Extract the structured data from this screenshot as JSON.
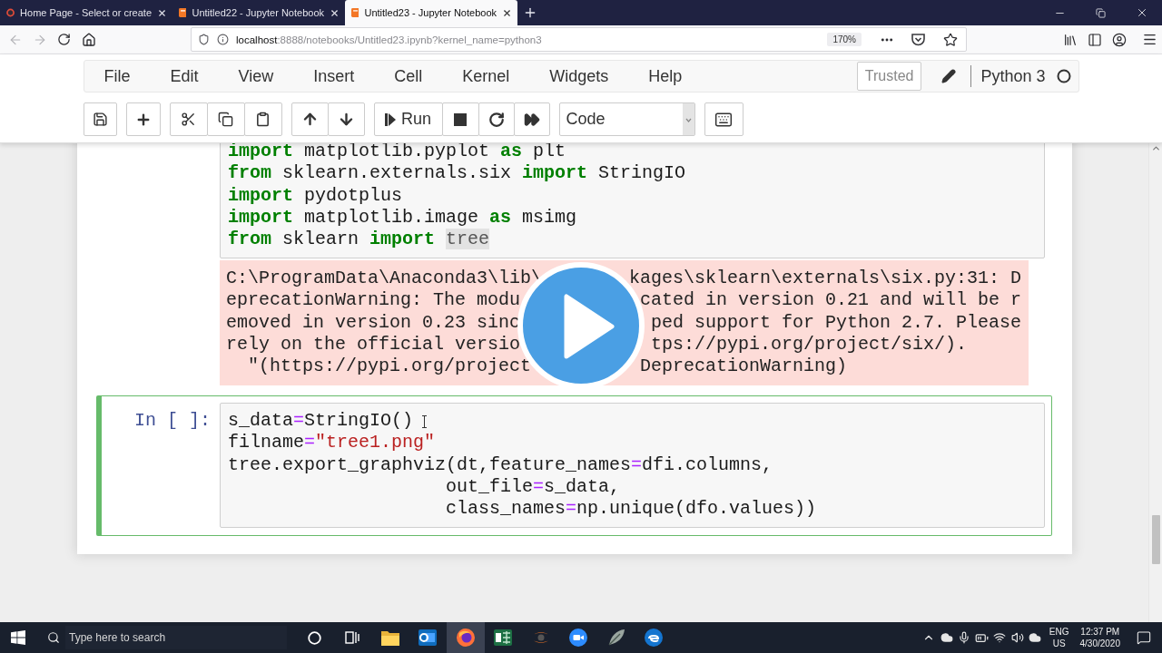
{
  "browser": {
    "tabs": [
      {
        "kind": "home",
        "title": "Home Page - Select or create",
        "selected": false
      },
      {
        "kind": "notebook",
        "title": "Untitled22 - Jupyter Notebook",
        "selected": false
      },
      {
        "kind": "notebook",
        "title": "Untitled23 - Jupyter Notebook",
        "selected": true
      }
    ],
    "back_disabled": true,
    "forward_disabled": true,
    "address": {
      "host": "localhost",
      "rest": ":8888/notebooks/Untitled23.ipynb?kernel_name=python3"
    },
    "zoom": "170%"
  },
  "notebook": {
    "menu": [
      "File",
      "Edit",
      "View",
      "Insert",
      "Cell",
      "Kernel",
      "Widgets",
      "Help"
    ],
    "trusted": "Trusted",
    "kernel": "Python 3",
    "kernel_busy": false,
    "toolbar": {
      "run": "Run",
      "cell_type": "Code"
    },
    "cells": [
      {
        "selected": false,
        "lines": [
          [
            {
              "kind": "kw",
              "text": "import"
            },
            {
              "kind": "name",
              "text": " matplotlib.pyplot "
            },
            {
              "kind": "kw",
              "text": "as"
            },
            {
              "kind": "name",
              "text": " plt"
            }
          ],
          [
            {
              "kind": "kw",
              "text": "from"
            },
            {
              "kind": "name",
              "text": " sklearn.externals.six "
            },
            {
              "kind": "kw",
              "text": "import"
            },
            {
              "kind": "name",
              "text": " StringIO"
            }
          ],
          [
            {
              "kind": "kw",
              "text": "import"
            },
            {
              "kind": "name",
              "text": " pydotplus"
            }
          ],
          [
            {
              "kind": "kw",
              "text": "import"
            },
            {
              "kind": "name",
              "text": " matplotlib.image "
            },
            {
              "kind": "kw",
              "text": "as"
            },
            {
              "kind": "name",
              "text": " msimg"
            }
          ],
          [
            {
              "kind": "kw",
              "text": "from"
            },
            {
              "kind": "name",
              "text": " sklearn "
            },
            {
              "kind": "kw",
              "text": "import "
            },
            {
              "kind": "match",
              "text": "tree"
            }
          ]
        ],
        "output": {
          "kind": "stderr",
          "lines": [
            {
              "left": "C:\\ProgramData\\Anaconda3\\lib\\",
              "right": "kages\\sklearn\\externals\\six.py:31: D"
            },
            {
              "left": "eprecationWarning: The modu",
              "right": "cated in version 0.21 and will be r"
            },
            {
              "left": "emoved in version 0.23 sinc",
              "right": "ped support for Python 2.7. Please"
            },
            {
              "left": "rely on the official versio",
              "right": "tps://pypi.org/project/six/)."
            },
            {
              "left": "  \"(https://pypi.org/project",
              "right": "DeprecationWarning)"
            }
          ]
        }
      },
      {
        "selected": true,
        "prompt": "In [ ]:",
        "lines": [
          [
            {
              "kind": "name",
              "text": "s_data"
            },
            {
              "kind": "op",
              "text": "="
            },
            {
              "kind": "name",
              "text": "StringIO()"
            }
          ],
          [
            {
              "kind": "name",
              "text": "filname"
            },
            {
              "kind": "op",
              "text": "="
            },
            {
              "kind": "str",
              "text": "\"tree1.png\""
            }
          ],
          [
            {
              "kind": "name",
              "text": "tree.export_graphviz(dt,feature_names"
            },
            {
              "kind": "op",
              "text": "="
            },
            {
              "kind": "name",
              "text": "dfi.columns,"
            }
          ],
          [
            {
              "kind": "name",
              "text": "                    out_file"
            },
            {
              "kind": "op",
              "text": "="
            },
            {
              "kind": "name",
              "text": "s_data,"
            }
          ],
          [
            {
              "kind": "name",
              "text": "                    class_names"
            },
            {
              "kind": "op",
              "text": "="
            },
            {
              "kind": "name",
              "text": "np.unique(dfo.values))"
            }
          ]
        ]
      }
    ]
  },
  "taskbar": {
    "search_placeholder": "Type here to search",
    "apps": [
      {
        "kind": "folder",
        "selected": false
      },
      {
        "kind": "mail",
        "selected": false
      },
      {
        "kind": "globe",
        "selected": true
      },
      {
        "kind": "sheet",
        "selected": false
      },
      {
        "kind": "orbit",
        "selected": false
      },
      {
        "kind": "video",
        "selected": false
      },
      {
        "kind": "leaf",
        "selected": false
      },
      {
        "kind": "swirl",
        "selected": false
      }
    ],
    "language": "ENG",
    "region": "US",
    "time": "12:37 PM",
    "date": "4/30/2020"
  }
}
